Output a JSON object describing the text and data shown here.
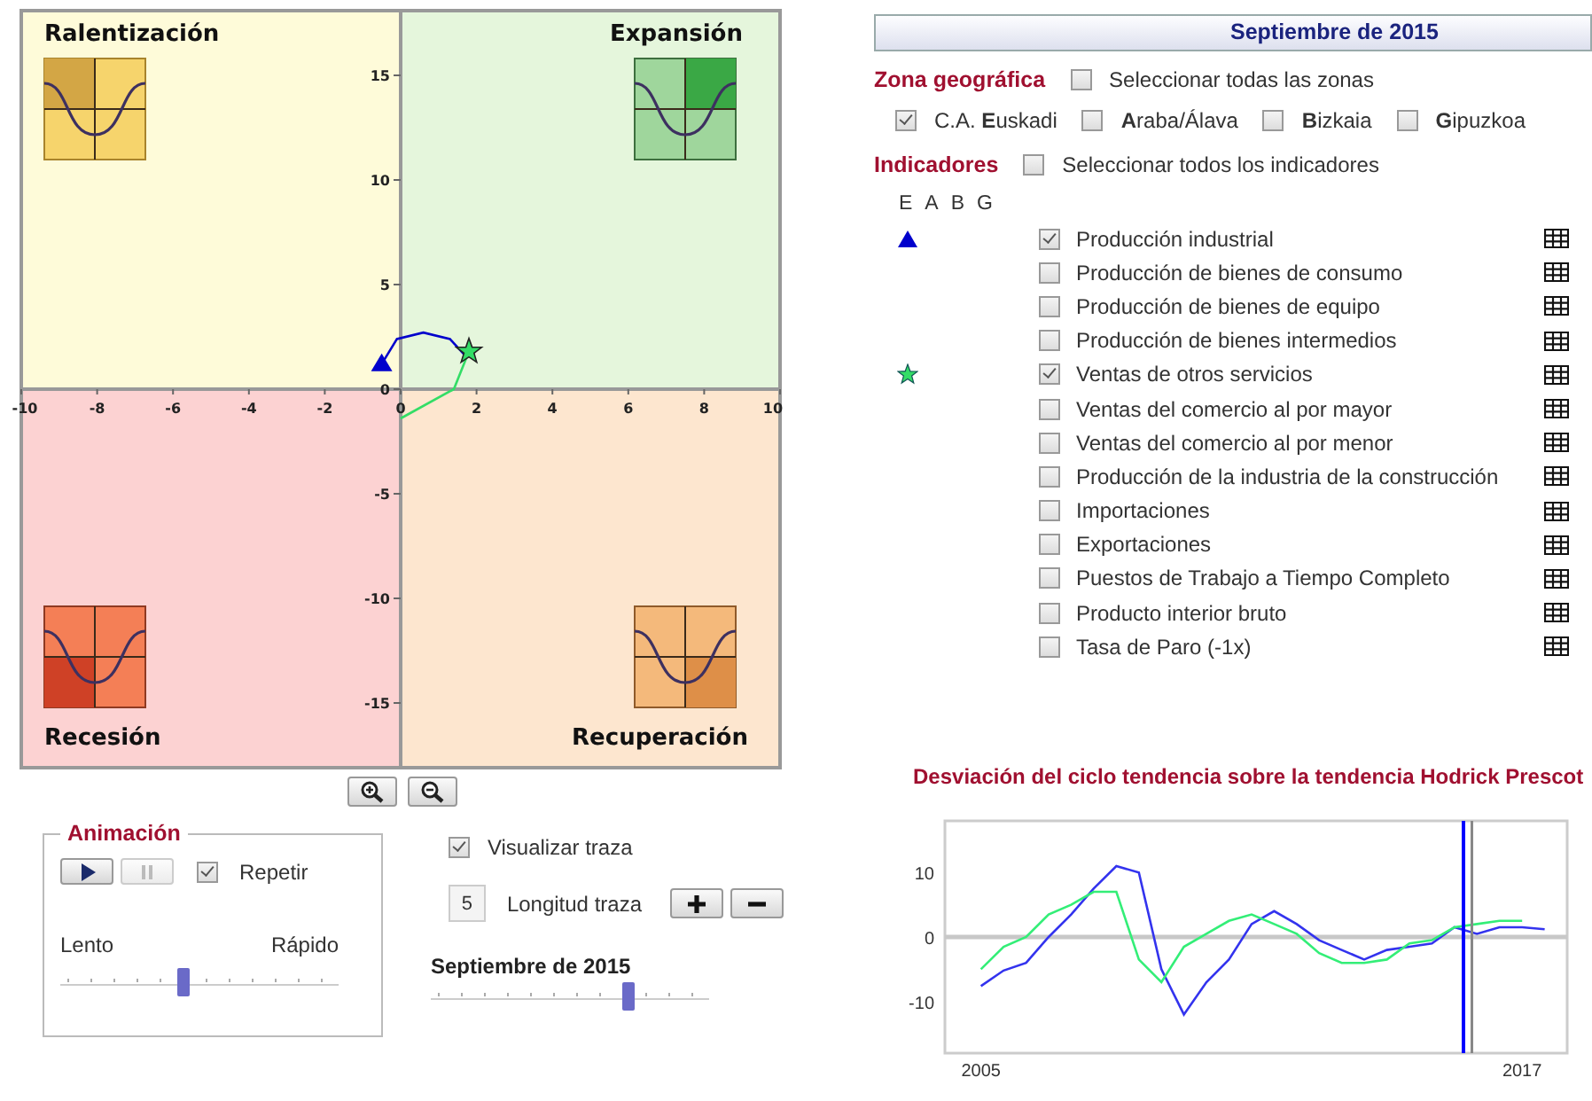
{
  "quadrant_chart": {
    "quadrants": [
      {
        "kind": "slowdown",
        "label": "Ralentización",
        "color": "#fefbd9"
      },
      {
        "kind": "expansion",
        "label": "Expansión",
        "color": "#e5f6dc"
      },
      {
        "kind": "recession",
        "label": "Recesión",
        "color": "#fcd2d2"
      },
      {
        "kind": "recovery",
        "label": "Recuperación",
        "color": "#fde6cf"
      }
    ],
    "x_axis_labels": [
      "-10",
      "-8",
      "-6",
      "-4",
      "-2",
      "0",
      "2",
      "4",
      "6",
      "8",
      "10"
    ],
    "y_axis_labels": [
      "15",
      "10",
      "5",
      "0",
      "-5",
      "-10",
      "-15"
    ]
  },
  "zoom_buttons": [
    {
      "kind": "zoom_in"
    },
    {
      "kind": "zoom_out"
    }
  ],
  "animation": {
    "title": "Animación",
    "play_controls": [
      {
        "kind": "play",
        "disabled": false
      },
      {
        "kind": "pause",
        "disabled": true
      }
    ],
    "repeat": {
      "label": "Repetir",
      "checked": true
    },
    "speed": {
      "min_label": "Lento",
      "max_label": "Rápido",
      "level": 0.44
    }
  },
  "trace": {
    "show": {
      "label": "Visualizar traza",
      "checked": true
    },
    "length_value": "5",
    "length_label": "Longitud traza",
    "length_buttons": [
      {
        "kind": "increase"
      },
      {
        "kind": "decrease"
      }
    ]
  },
  "time_slider": {
    "label": "Septiembre de 2015",
    "level": 0.72
  },
  "period_header": "Septiembre de 2015",
  "zones": {
    "title": "Zona geográfica",
    "select_all": {
      "label": "Seleccionar todas las zonas",
      "checked": false
    },
    "items": [
      {
        "label": "C.A. **E**uskadi",
        "checked": true
      },
      {
        "label": "**A**raba/Álava",
        "checked": false
      },
      {
        "label": "**B**izkaia",
        "checked": false
      },
      {
        "label": "**G**ipuzkoa",
        "checked": false
      }
    ]
  },
  "indicators": {
    "title": "Indicadores",
    "select_all": {
      "label": "Seleccionar todos los indicadores",
      "checked": false
    },
    "columns": [
      "E",
      "A",
      "B",
      "G"
    ],
    "items": [
      {
        "label": "Producción industrial",
        "checked": true,
        "kind": "triangle",
        "color": "#0000cc"
      },
      {
        "label": "Producción de bienes de consumo",
        "checked": false
      },
      {
        "label": "Producción de bienes de equipo",
        "checked": false
      },
      {
        "label": "Producción de bienes intermedios",
        "checked": false
      },
      {
        "label": "Ventas de otros servicios",
        "checked": true,
        "kind": "star",
        "color": "#33dd66"
      },
      {
        "label": "Ventas del comercio al por mayor",
        "checked": false
      },
      {
        "label": "Ventas del comercio al por menor",
        "checked": false
      },
      {
        "label": "Producción de la industria de la construcción",
        "checked": false
      },
      {
        "label": "Importaciones",
        "checked": false
      },
      {
        "label": "Exportaciones",
        "checked": false
      },
      {
        "label": "Puestos de Trabajo a Tiempo Completo",
        "checked": false
      },
      {
        "label": "Producto interior bruto",
        "checked": false
      },
      {
        "label": "Tasa de Paro (-1x)",
        "checked": false
      }
    ]
  },
  "deviation_chart": {
    "chart_data": {
      "type": "line",
      "title": "Desviación del ciclo tendencia sobre la tendencia Hodrick Prescot",
      "xlim": [
        2004.2,
        2018
      ],
      "ylim": [
        -18,
        18
      ],
      "xticks": [
        2005,
        2017
      ],
      "yticks": [
        -10,
        0,
        10
      ],
      "x": [
        2005,
        2005.5,
        2006,
        2006.5,
        2007,
        2007.5,
        2008,
        2008.5,
        2009,
        2009.5,
        2010,
        2010.5,
        2011,
        2011.5,
        2012,
        2012.5,
        2013,
        2013.5,
        2014,
        2014.5,
        2015,
        2015.5,
        2016,
        2016.5,
        2017,
        2017.5
      ],
      "series": [
        {
          "color": "#3333ee",
          "values": [
            -7.6,
            -5.2,
            -4,
            0,
            3.5,
            7.5,
            11,
            10,
            -5,
            -12,
            -7,
            -3.5,
            2,
            4,
            2,
            -0.5,
            -2,
            -3.5,
            -2,
            -1.5,
            -1,
            1.5,
            0.5,
            1.5,
            1.5,
            1.2
          ]
        },
        {
          "color": "#33ee77",
          "values": [
            -5,
            -1.5,
            0,
            3.5,
            5,
            7,
            7,
            -3.5,
            -7,
            -1.5,
            0.5,
            2.5,
            3.5,
            2,
            0.5,
            -2.5,
            -4,
            -4,
            -3.5,
            -1,
            -0.5,
            1.5,
            2,
            2.5,
            2.5,
            null
          ]
        }
      ]
    }
  }
}
